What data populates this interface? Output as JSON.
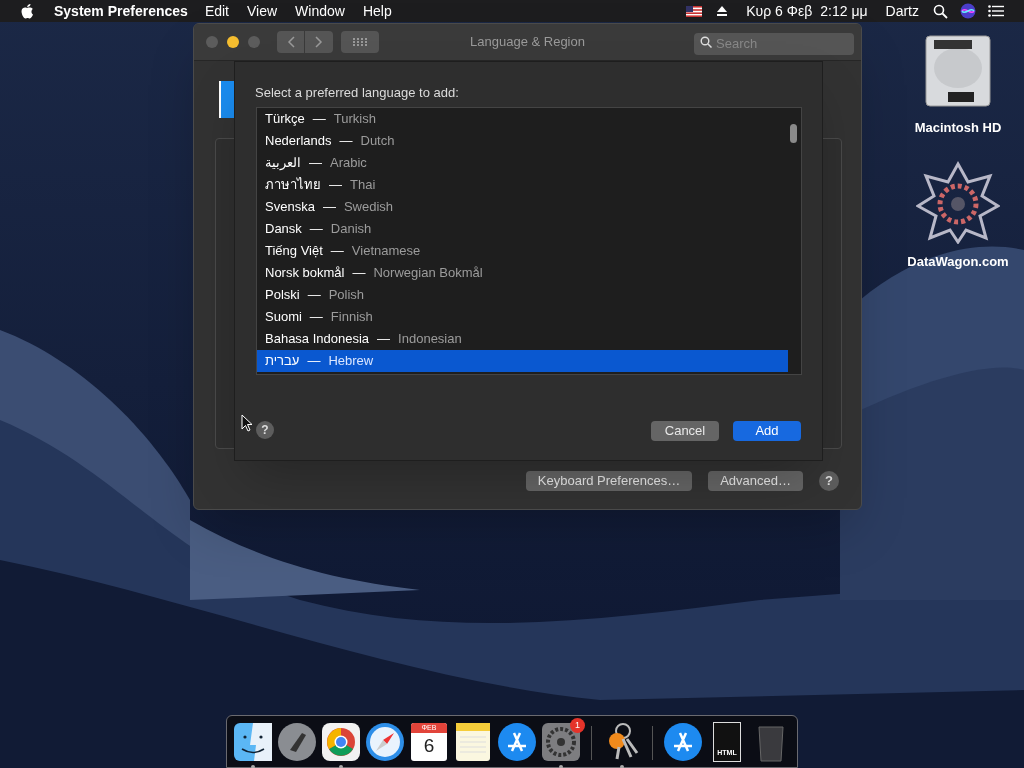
{
  "menu_bar": {
    "app": "System Preferences",
    "menus": [
      "Edit",
      "View",
      "Window",
      "Help"
    ],
    "date": "Κυρ 6 Φεβ",
    "time": "2:12 μμ",
    "user": "Dartz"
  },
  "desktop_icons": [
    {
      "kind": "disk",
      "label": "Macintosh HD"
    },
    {
      "kind": "star",
      "label": "DataWagon.com"
    }
  ],
  "window": {
    "title": "Language & Region",
    "search": {
      "placeholder": "Search"
    },
    "buttons": [
      "Keyboard Preferences…",
      "Advanced…"
    ],
    "help": "?"
  },
  "sheet": {
    "prompt": "Select a preferred language to add:",
    "languages": [
      {
        "native": "Türkçe",
        "separator": "—",
        "english": "Turkish",
        "selected": false
      },
      {
        "native": "Nederlands",
        "separator": "—",
        "english": "Dutch",
        "selected": false
      },
      {
        "native": "العربية",
        "separator": "—",
        "english": "Arabic",
        "selected": false
      },
      {
        "native": "ภาษาไทย",
        "separator": "—",
        "english": "Thai",
        "selected": false
      },
      {
        "native": "Svenska",
        "separator": "—",
        "english": "Swedish",
        "selected": false
      },
      {
        "native": "Dansk",
        "separator": "—",
        "english": "Danish",
        "selected": false
      },
      {
        "native": "Tiếng Việt",
        "separator": "—",
        "english": "Vietnamese",
        "selected": false
      },
      {
        "native": "Norsk bokmål",
        "separator": "—",
        "english": "Norwegian Bokmål",
        "selected": false
      },
      {
        "native": "Polski",
        "separator": "—",
        "english": "Polish",
        "selected": false
      },
      {
        "native": "Suomi",
        "separator": "—",
        "english": "Finnish",
        "selected": false
      },
      {
        "native": "Bahasa Indonesia",
        "separator": "—",
        "english": "Indonesian",
        "selected": false
      },
      {
        "native": "עברית",
        "separator": "—",
        "english": "Hebrew",
        "selected": true
      }
    ],
    "help": "?",
    "buttons": [
      {
        "label": "Cancel",
        "default": false
      },
      {
        "label": "Add",
        "default": true
      }
    ]
  },
  "dock": {
    "items": [
      {
        "kind": "finder",
        "running": true
      },
      {
        "kind": "launchpad",
        "running": false
      },
      {
        "kind": "chrome",
        "running": true
      },
      {
        "kind": "safari",
        "running": false
      },
      {
        "kind": "calendar",
        "month": "ΦΕΒ",
        "day": "6",
        "running": false
      },
      {
        "kind": "notes",
        "running": false
      },
      {
        "kind": "appstore",
        "running": false
      },
      {
        "kind": "settings",
        "badge": "1",
        "running": true
      },
      {
        "kind": "separator"
      },
      {
        "kind": "keychain",
        "running": true
      },
      {
        "kind": "separator"
      },
      {
        "kind": "appstore",
        "running": false
      },
      {
        "kind": "document",
        "label": "HTML",
        "running": false
      },
      {
        "kind": "trash",
        "running": false
      }
    ]
  }
}
